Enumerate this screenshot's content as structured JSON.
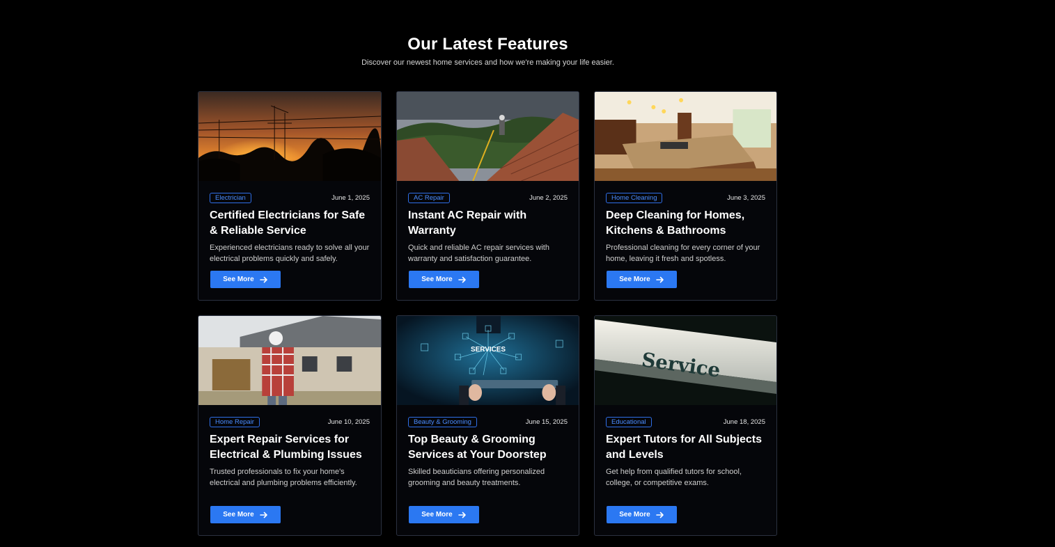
{
  "section": {
    "title": "Our Latest Features",
    "subtitle": "Discover our newest home services and how we're making your life easier."
  },
  "colors": {
    "accent": "#2b78f2",
    "tag": "#4b8dff",
    "background": "#000000"
  },
  "cards": [
    {
      "tag": "Electrician",
      "date": "June 1, 2025",
      "title": "Certified Electricians for Safe & Reliable Service",
      "description": "Experienced electricians ready to solve all your electrical problems quickly and safely.",
      "button": "See More",
      "image": "sunset-power-lines"
    },
    {
      "tag": "AC Repair",
      "date": "June 2, 2025",
      "title": "Instant AC Repair with Warranty",
      "description": "Quick and reliable AC repair services with warranty and satisfaction guarantee.",
      "button": "See More",
      "image": "roof-worker"
    },
    {
      "tag": "Home Cleaning",
      "date": "June 3, 2025",
      "title": "Deep Cleaning for Homes, Kitchens & Bathrooms",
      "description": "Professional cleaning for every corner of your home, leaving it fresh and spotless.",
      "button": "See More",
      "image": "kitchen-interior"
    },
    {
      "tag": "Home Repair",
      "date": "June 10, 2025",
      "title": "Expert Repair Services for Electrical & Plumbing Issues",
      "description": "Trusted professionals to fix your home's electrical and plumbing problems efficiently.",
      "button": "See More",
      "image": "house-builder"
    },
    {
      "tag": "Beauty & Grooming",
      "date": "June 15, 2025",
      "title": "Top Beauty & Grooming Services at Your Doorstep",
      "description": "Skilled beauticians offering personalized grooming and beauty treatments.",
      "button": "See More",
      "image": "services-tablet",
      "image_text": "SERVICES"
    },
    {
      "tag": "Educational",
      "date": "June 18, 2025",
      "title": "Expert Tutors for All Subjects and Levels",
      "description": "Get help from qualified tutors for school, college, or competitive exams.",
      "button": "See More",
      "image": "service-sign",
      "image_text": "Service"
    }
  ]
}
